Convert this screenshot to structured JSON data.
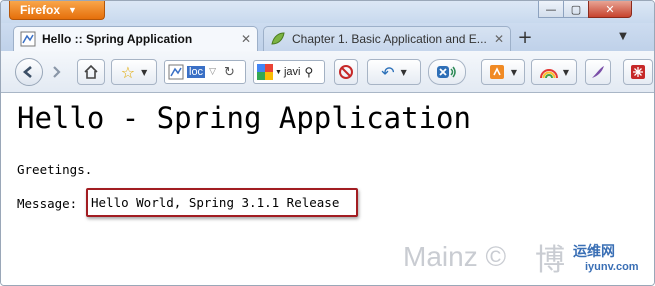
{
  "browser": {
    "app_button_label": "Firefox",
    "tabs": [
      {
        "label": "Hello :: Spring Application",
        "active": true
      },
      {
        "label": "Chapter 1. Basic Application and E...",
        "active": false
      }
    ],
    "address": {
      "text": "loc"
    },
    "search": {
      "text": "javi"
    },
    "window_controls": {
      "minimize": "—",
      "maximize": "▢",
      "close": "✕"
    }
  },
  "page": {
    "heading": "Hello - Spring Application",
    "greeting": "Greetings.",
    "message_label": "Message:",
    "message_value": "Hello World, Spring 3.1.1 Release"
  },
  "watermark": {
    "author": "Mainz ©",
    "chinese": "博",
    "site_cn": "运维网",
    "site_domain": "iyunv.com"
  },
  "colors": {
    "accent_orange": "#e56f0b",
    "highlight_box": "#a21d22"
  }
}
